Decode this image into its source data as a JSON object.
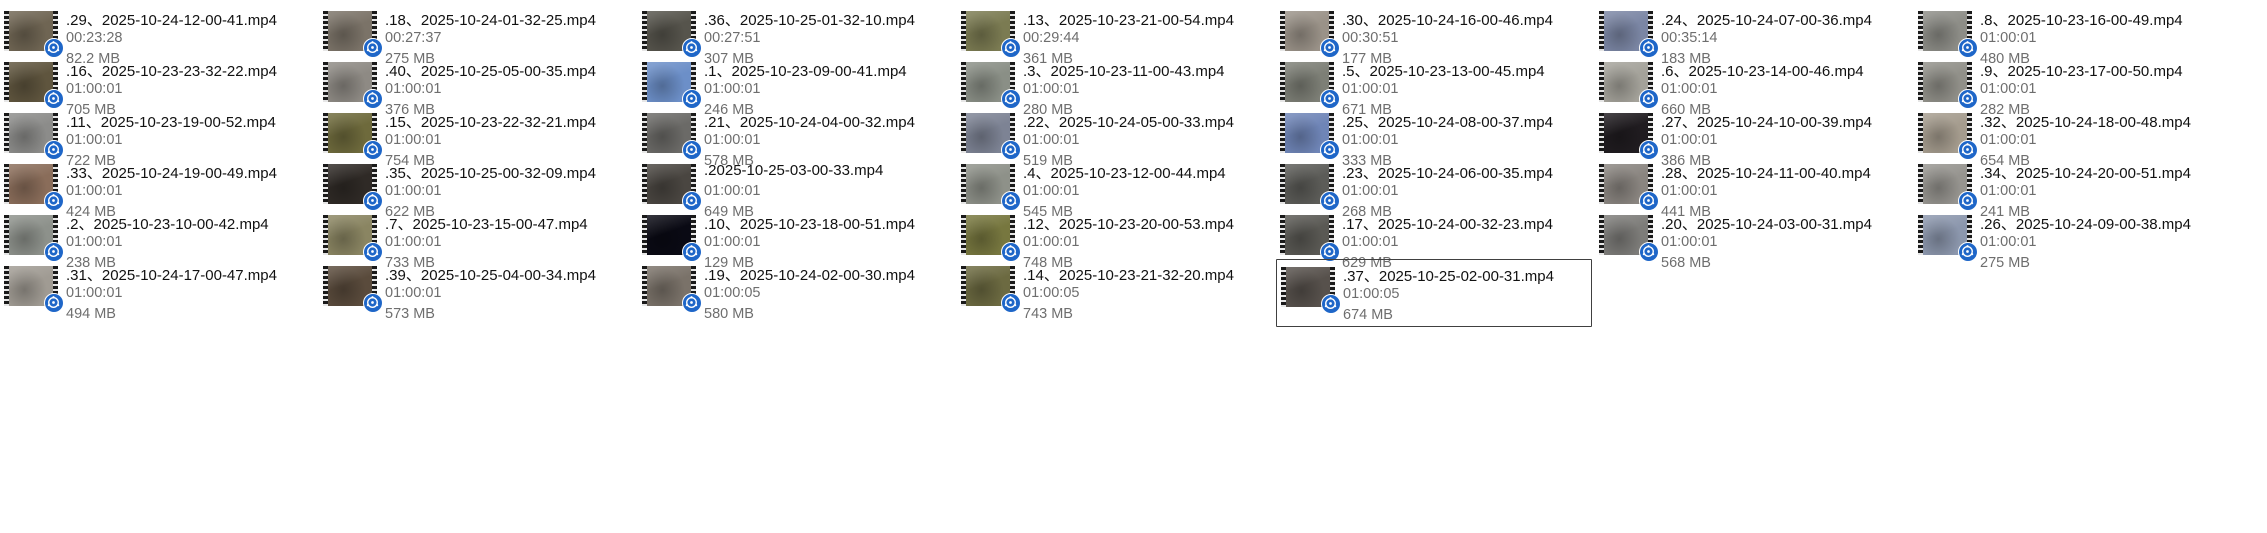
{
  "files": [
    {
      "name": ".29、2025-10-24-12-00-41.mp4",
      "duration": "00:23:28",
      "size": "82.2 MB",
      "thumb": "#6f6553"
    },
    {
      "name": ".18、2025-10-24-01-32-25.mp4",
      "duration": "00:27:37",
      "size": "275 MB",
      "thumb": "#7b7368"
    },
    {
      "name": ".36、2025-10-25-01-32-10.mp4",
      "duration": "00:27:51",
      "size": "307 MB",
      "thumb": "#56544c"
    },
    {
      "name": ".13、2025-10-23-21-00-54.mp4",
      "duration": "00:29:44",
      "size": "361 MB",
      "thumb": "#7b7b52"
    },
    {
      "name": ".30、2025-10-24-16-00-46.mp4",
      "duration": "00:30:51",
      "size": "177 MB",
      "thumb": "#9a9288"
    },
    {
      "name": ".24、2025-10-24-07-00-36.mp4",
      "duration": "00:35:14",
      "size": "183 MB",
      "thumb": "#7b86a4"
    },
    {
      "name": ".8、2025-10-23-16-00-49.mp4",
      "duration": "01:00:01",
      "size": "480 MB",
      "thumb": "#8d8d87"
    },
    {
      "name": ".16、2025-10-23-23-32-22.mp4",
      "duration": "01:00:01",
      "size": "705 MB",
      "thumb": "#5f553e"
    },
    {
      "name": ".40、2025-10-25-05-00-35.mp4",
      "duration": "01:00:01",
      "size": "376 MB",
      "thumb": "#8e8a84"
    },
    {
      "name": ".1、2025-10-23-09-00-41.mp4",
      "duration": "01:00:01",
      "size": "246 MB",
      "thumb": "#6c8fc8"
    },
    {
      "name": ".3、2025-10-23-11-00-43.mp4",
      "duration": "01:00:01",
      "size": "280 MB",
      "thumb": "#8a8f86"
    },
    {
      "name": ".5、2025-10-23-13-00-45.mp4",
      "duration": "01:00:01",
      "size": "671 MB",
      "thumb": "#7d7f76"
    },
    {
      "name": ".6、2025-10-23-14-00-46.mp4",
      "duration": "01:00:01",
      "size": "660 MB",
      "thumb": "#a4a29a"
    },
    {
      "name": ".9、2025-10-23-17-00-50.mp4",
      "duration": "01:00:01",
      "size": "282 MB",
      "thumb": "#919089"
    },
    {
      "name": ".11、2025-10-23-19-00-52.mp4",
      "duration": "01:00:01",
      "size": "722 MB",
      "thumb": "#8c8c8a"
    },
    {
      "name": ".15、2025-10-23-22-32-21.mp4",
      "duration": "01:00:01",
      "size": "754 MB",
      "thumb": "#6e6a3c"
    },
    {
      "name": ".21、2025-10-24-04-00-32.mp4",
      "duration": "01:00:01",
      "size": "578 MB",
      "thumb": "#6b6a67"
    },
    {
      "name": ".22、2025-10-24-05-00-33.mp4",
      "duration": "01:00:01",
      "size": "519 MB",
      "thumb": "#7d8394"
    },
    {
      "name": ".25、2025-10-24-08-00-37.mp4",
      "duration": "01:00:01",
      "size": "333 MB",
      "thumb": "#6f85b7"
    },
    {
      "name": ".27、2025-10-24-10-00-39.mp4",
      "duration": "01:00:01",
      "size": "386 MB",
      "thumb": "#201c20"
    },
    {
      "name": ".32、2025-10-24-18-00-48.mp4",
      "duration": "01:00:01",
      "size": "654 MB",
      "thumb": "#a59c8e"
    },
    {
      "name": ".33、2025-10-24-19-00-49.mp4",
      "duration": "01:00:01",
      "size": "424 MB",
      "thumb": "#8a6d5a"
    },
    {
      "name": ".35、2025-10-25-00-32-09.mp4",
      "duration": "01:00:01",
      "size": "622 MB",
      "thumb": "#2f2a26"
    },
    {
      "name": ".2025-10-25-03-00-33.mp4",
      "duration": "01:00:01",
      "size": "649 MB",
      "thumb": "#4a4641"
    },
    {
      "name": ".4、2025-10-23-12-00-44.mp4",
      "duration": "01:00:01",
      "size": "545 MB",
      "thumb": "#8e9189"
    },
    {
      "name": ".23、2025-10-24-06-00-35.mp4",
      "duration": "01:00:01",
      "size": "268 MB",
      "thumb": "#5c5c58"
    },
    {
      "name": ".28、2025-10-24-11-00-40.mp4",
      "duration": "01:00:01",
      "size": "441 MB",
      "thumb": "#8a8580"
    },
    {
      "name": ".34、2025-10-24-20-00-51.mp4",
      "duration": "01:00:01",
      "size": "241 MB",
      "thumb": "#96948f"
    },
    {
      "name": ".2、2025-10-23-10-00-42.mp4",
      "duration": "01:00:01",
      "size": "238 MB",
      "thumb": "#8d918b"
    },
    {
      "name": ".7、2025-10-23-15-00-47.mp4",
      "duration": "01:00:01",
      "size": "733 MB",
      "thumb": "#8a8562"
    },
    {
      "name": ".10、2025-10-23-18-00-51.mp4",
      "duration": "01:00:01",
      "size": "129 MB",
      "thumb": "#0a0a14"
    },
    {
      "name": ".12、2025-10-23-20-00-53.mp4",
      "duration": "01:00:01",
      "size": "748 MB",
      "thumb": "#77773f"
    },
    {
      "name": ".17、2025-10-24-00-32-23.mp4",
      "duration": "01:00:01",
      "size": "629 MB",
      "thumb": "#5a5954"
    },
    {
      "name": ".20、2025-10-24-03-00-31.mp4",
      "duration": "01:00:01",
      "size": "568 MB",
      "thumb": "#7d7c79"
    },
    {
      "name": ".26、2025-10-24-09-00-38.mp4",
      "duration": "01:00:01",
      "size": "275 MB",
      "thumb": "#8c97ad"
    },
    {
      "name": ".31、2025-10-24-17-00-47.mp4",
      "duration": "01:00:01",
      "size": "494 MB",
      "thumb": "#a09b93"
    },
    {
      "name": ".39、2025-10-25-04-00-34.mp4",
      "duration": "01:00:01",
      "size": "573 MB",
      "thumb": "#5a4b3c"
    },
    {
      "name": ".19、2025-10-24-02-00-30.mp4",
      "duration": "01:00:05",
      "size": "580 MB",
      "thumb": "#7a7269"
    },
    {
      "name": ".14、2025-10-23-21-32-20.mp4",
      "duration": "01:00:05",
      "size": "743 MB",
      "thumb": "#6c6a41"
    },
    {
      "name": ".37、2025-10-25-02-00-31.mp4",
      "duration": "01:00:05",
      "size": "674 MB",
      "thumb": "#57514c",
      "selected": true
    }
  ],
  "icons": {
    "thumbnail": "video-thumbnail-icon",
    "badge": "media-player-badge-icon"
  },
  "colors": {
    "badge": "#1e66c8",
    "selection_border": "#404040",
    "meta_text": "#6e6e6e"
  }
}
